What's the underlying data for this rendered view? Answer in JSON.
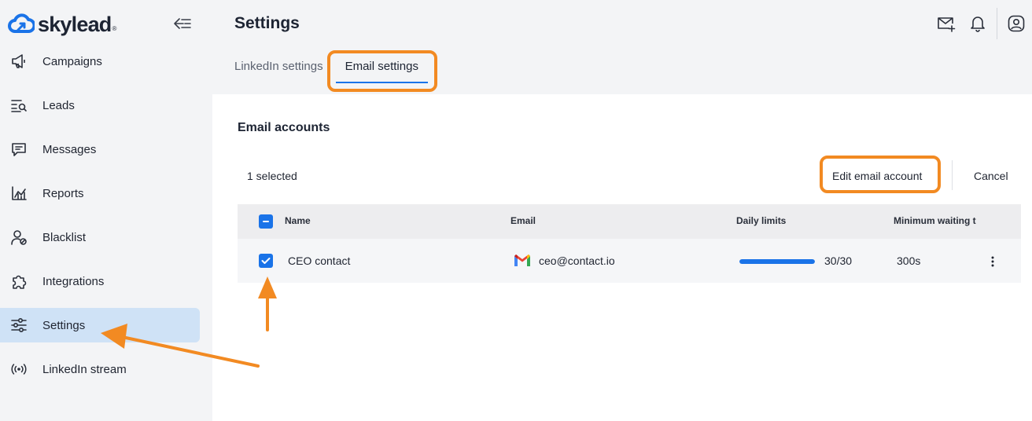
{
  "brand": {
    "name": "skylead",
    "reg": "®",
    "accent": "#1a73e8",
    "highlight": "#f28a22"
  },
  "sidebar": {
    "items": [
      {
        "label": "Campaigns",
        "icon": "megaphone-icon"
      },
      {
        "label": "Leads",
        "icon": "list-search-icon"
      },
      {
        "label": "Messages",
        "icon": "message-icon"
      },
      {
        "label": "Reports",
        "icon": "chart-icon"
      },
      {
        "label": "Blacklist",
        "icon": "user-block-icon"
      },
      {
        "label": "Integrations",
        "icon": "puzzle-icon"
      },
      {
        "label": "Settings",
        "icon": "sliders-icon",
        "active": true
      },
      {
        "label": "LinkedIn stream",
        "icon": "broadcast-icon"
      }
    ]
  },
  "header": {
    "title": "Settings",
    "tabs": [
      {
        "label": "LinkedIn settings"
      },
      {
        "label": "Email settings",
        "active": true
      }
    ]
  },
  "email_accounts": {
    "title": "Email accounts",
    "selected_label": "1 selected",
    "edit_label": "Edit email account",
    "cancel_label": "Cancel",
    "columns": [
      "Name",
      "Email",
      "Daily limits",
      "Minimum waiting t"
    ],
    "rows": [
      {
        "name": "CEO contact",
        "email": "ceo@contact.io",
        "daily_limit": "30/30",
        "daily_limit_fraction": 1.0,
        "min_wait": "300s",
        "selected": true
      }
    ]
  }
}
